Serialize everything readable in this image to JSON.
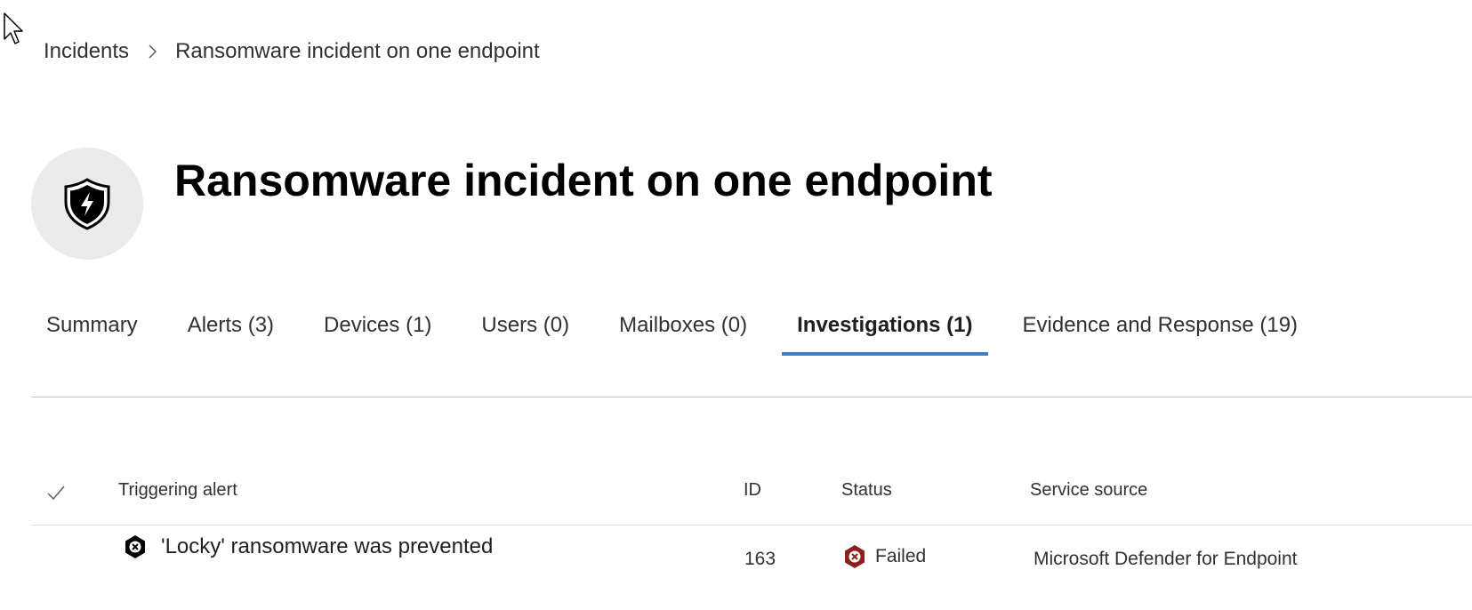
{
  "breadcrumb": {
    "root": "Incidents",
    "current": "Ransomware incident on one endpoint"
  },
  "incident": {
    "title": "Ransomware incident on one endpoint",
    "icon": "shield-lightning-icon"
  },
  "tabs": [
    {
      "label": "Summary",
      "active": false
    },
    {
      "label": "Alerts (3)",
      "active": false
    },
    {
      "label": "Devices (1)",
      "active": false
    },
    {
      "label": "Users (0)",
      "active": false
    },
    {
      "label": "Mailboxes (0)",
      "active": false
    },
    {
      "label": "Investigations (1)",
      "active": true
    },
    {
      "label": "Evidence and Response (19)",
      "active": false
    }
  ],
  "table": {
    "columns": {
      "alert": "Triggering alert",
      "id": "ID",
      "status": "Status",
      "source": "Service source"
    },
    "rows": [
      {
        "alert": "'Locky' ransomware was prevented",
        "id": "163",
        "status": "Failed",
        "source": "Microsoft Defender for Endpoint"
      }
    ]
  },
  "colors": {
    "accent": "#3b82c9",
    "failed": "#8e1f1f",
    "avatar_bg": "#ebebeb"
  }
}
